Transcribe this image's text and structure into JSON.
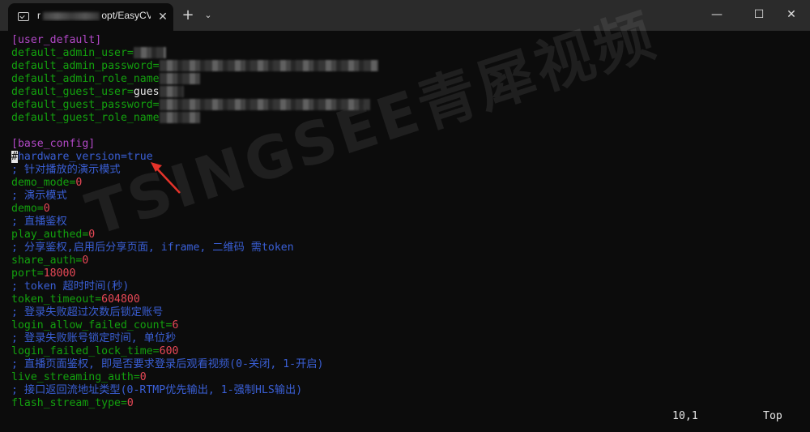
{
  "tab": {
    "title_suffix": "opt/EasyCVR-",
    "title_prefix": "r",
    "close": "✕"
  },
  "titlebar": {
    "new_tab": "+",
    "dropdown": "⌄",
    "minimize": "—",
    "maximize": "☐",
    "close": "✕"
  },
  "watermark": "TSINGSEE青犀视频",
  "lines": [
    [
      {
        "t": "[user_default]",
        "c": "sec"
      }
    ],
    [
      {
        "t": "default_admin_user=",
        "c": "key"
      },
      {
        "censor": 40
      }
    ],
    [
      {
        "t": "default_admin_password=",
        "c": "key"
      },
      {
        "censor": 270
      }
    ],
    [
      {
        "t": "default_admin_role_name",
        "c": "key"
      },
      {
        "censor": 50
      }
    ],
    [
      {
        "t": "default_guest_user=",
        "c": "key"
      },
      {
        "t": "gues",
        "c": "plain"
      },
      {
        "censor": 30
      }
    ],
    [
      {
        "t": "default_guest_password=",
        "c": "key"
      },
      {
        "censor": 260
      }
    ],
    [
      {
        "t": "default_guest_role_name",
        "c": "key"
      },
      {
        "censor": 50
      }
    ],
    [],
    [
      {
        "t": "[base_config]",
        "c": "sec"
      }
    ],
    [
      {
        "t": "#",
        "c": "cmt",
        "cursor": true
      },
      {
        "t": "hardware_version=true",
        "c": "cmt"
      }
    ],
    [
      {
        "t": "; 针对播放的演示模式",
        "c": "cmt"
      }
    ],
    [
      {
        "t": "demo_mode=",
        "c": "key"
      },
      {
        "t": "0",
        "c": "val"
      }
    ],
    [
      {
        "t": "; 演示模式",
        "c": "cmt"
      }
    ],
    [
      {
        "t": "demo=",
        "c": "key"
      },
      {
        "t": "0",
        "c": "val"
      }
    ],
    [
      {
        "t": "; 直播鉴权",
        "c": "cmt"
      }
    ],
    [
      {
        "t": "play_authed=",
        "c": "key"
      },
      {
        "t": "0",
        "c": "val"
      }
    ],
    [
      {
        "t": "; 分享鉴权,启用后分享页面, iframe, 二维码 需token",
        "c": "cmt"
      }
    ],
    [
      {
        "t": "share_auth=",
        "c": "key"
      },
      {
        "t": "0",
        "c": "val"
      }
    ],
    [
      {
        "t": "port=",
        "c": "key"
      },
      {
        "t": "18000",
        "c": "val"
      }
    ],
    [
      {
        "t": "; token 超时时间(秒)",
        "c": "cmt"
      }
    ],
    [
      {
        "t": "token_timeout=",
        "c": "key"
      },
      {
        "t": "604800",
        "c": "val"
      }
    ],
    [
      {
        "t": "; 登录失败超过次数后锁定账号",
        "c": "cmt"
      }
    ],
    [
      {
        "t": "login_allow_failed_count=",
        "c": "key"
      },
      {
        "t": "6",
        "c": "val"
      }
    ],
    [
      {
        "t": "; 登录失败账号锁定时间, 单位秒",
        "c": "cmt"
      }
    ],
    [
      {
        "t": "login_failed_lock_time=",
        "c": "key"
      },
      {
        "t": "600",
        "c": "val"
      }
    ],
    [
      {
        "t": "; 直播页面鉴权, 即是否要求登录后观看视频(0-关闭, 1-开启)",
        "c": "cmt"
      }
    ],
    [
      {
        "t": "live_streaming_auth=",
        "c": "key"
      },
      {
        "t": "0",
        "c": "val"
      }
    ],
    [
      {
        "t": "; 接口返回流地址类型(0-RTMP优先输出, 1-强制HLS输出)",
        "c": "cmt"
      }
    ],
    [
      {
        "t": "flash_stream_type=",
        "c": "key"
      },
      {
        "t": "0",
        "c": "val"
      }
    ]
  ],
  "status": {
    "position": "10,1",
    "scroll": "Top"
  },
  "colors": {
    "section": "#b148c6",
    "key": "#13a10e",
    "comment": "#3a5fd6",
    "value": "#e74856"
  }
}
